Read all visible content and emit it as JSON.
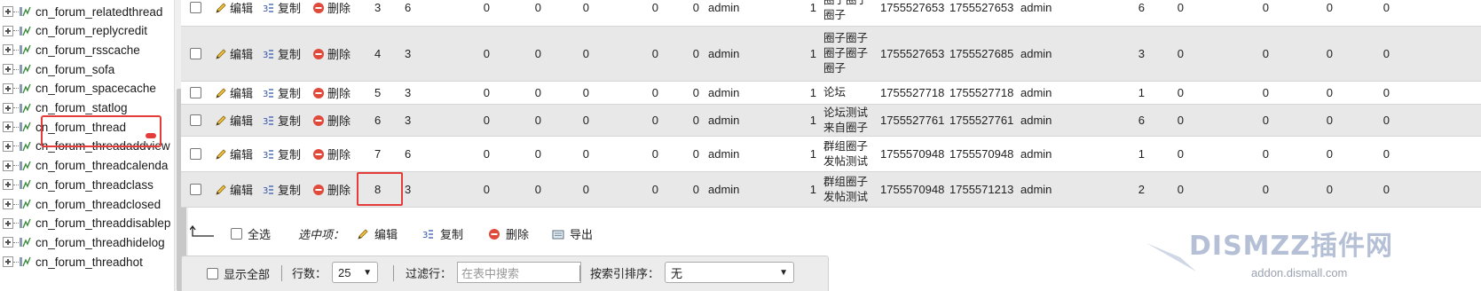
{
  "nav": {
    "items": [
      {
        "label": "cn_forum_relatedthread"
      },
      {
        "label": "cn_forum_replycredit"
      },
      {
        "label": "cn_forum_rsscache"
      },
      {
        "label": "cn_forum_sofa"
      },
      {
        "label": "cn_forum_spacecache"
      },
      {
        "label": "cn_forum_statlog"
      },
      {
        "label": "cn_forum_thread"
      },
      {
        "label": "cn_forum_threadaddview"
      },
      {
        "label": "cn_forum_threadcalenda"
      },
      {
        "label": "cn_forum_threadclass"
      },
      {
        "label": "cn_forum_threadclosed"
      },
      {
        "label": "cn_forum_threaddisablep"
      },
      {
        "label": "cn_forum_threadhidelog"
      },
      {
        "label": "cn_forum_threadhot"
      }
    ],
    "selected": "cn_forum_thread"
  },
  "actions": {
    "edit": "编辑",
    "copy": "复制",
    "delete": "删除"
  },
  "rows": [
    {
      "tid": "3",
      "fid": "6",
      "c1": "0",
      "c2": "0",
      "c3": "0",
      "c4": "0",
      "c5": "0",
      "author": "admin",
      "c6": "1",
      "subject": "圈子圈子圈子",
      "dateline": "1755527653",
      "lastpost": "1755527653",
      "lastposter": "admin",
      "c7": "6",
      "c8": "0",
      "c9": "0",
      "c10": "0",
      "c11": "0"
    },
    {
      "tid": "4",
      "fid": "3",
      "c1": "0",
      "c2": "0",
      "c3": "0",
      "c4": "0",
      "c5": "0",
      "author": "admin",
      "c6": "1",
      "subject": "圈子圈子圈子圈子圈子",
      "dateline": "1755527653",
      "lastpost": "1755527685",
      "lastposter": "admin",
      "c7": "3",
      "c8": "0",
      "c9": "0",
      "c10": "0",
      "c11": "0"
    },
    {
      "tid": "5",
      "fid": "3",
      "c1": "0",
      "c2": "0",
      "c3": "0",
      "c4": "0",
      "c5": "0",
      "author": "admin",
      "c6": "1",
      "subject": "论坛",
      "dateline": "1755527718",
      "lastpost": "1755527718",
      "lastposter": "admin",
      "c7": "1",
      "c8": "0",
      "c9": "0",
      "c10": "0",
      "c11": "0"
    },
    {
      "tid": "6",
      "fid": "3",
      "c1": "0",
      "c2": "0",
      "c3": "0",
      "c4": "0",
      "c5": "0",
      "author": "admin",
      "c6": "1",
      "subject": "论坛测试来自圈子",
      "dateline": "1755527761",
      "lastpost": "1755527761",
      "lastposter": "admin",
      "c7": "6",
      "c8": "0",
      "c9": "0",
      "c10": "0",
      "c11": "0"
    },
    {
      "tid": "7",
      "fid": "6",
      "c1": "0",
      "c2": "0",
      "c3": "0",
      "c4": "0",
      "c5": "0",
      "author": "admin",
      "c6": "1",
      "subject": "群组圈子发帖测试",
      "dateline": "1755570948",
      "lastpost": "1755570948",
      "lastposter": "admin",
      "c7": "1",
      "c8": "0",
      "c9": "0",
      "c10": "0",
      "c11": "0"
    },
    {
      "tid": "8",
      "fid": "3",
      "c1": "0",
      "c2": "0",
      "c3": "0",
      "c4": "0",
      "c5": "0",
      "author": "admin",
      "c6": "1",
      "subject": "群组圈子发帖测试",
      "dateline": "1755570948",
      "lastpost": "1755571213",
      "lastposter": "admin",
      "c7": "2",
      "c8": "0",
      "c9": "0",
      "c10": "0",
      "c11": "0"
    }
  ],
  "bulk": {
    "select_all": "全选",
    "with_selected": "选中项：",
    "edit": "编辑",
    "copy": "复制",
    "delete": "删除",
    "export": "导出"
  },
  "bottom": {
    "show_all": "显示全部",
    "rows_label": "行数：",
    "rows_value": "25",
    "filter_label": "过滤行：",
    "filter_placeholder": "在表中搜索",
    "sort_label": "按索引排序：",
    "sort_value": "无"
  },
  "watermark": {
    "text": "DISMZZ插件网",
    "sub": "addon.dismall.com"
  },
  "colors": {
    "highlight": "#e43b3b",
    "row_alt": "#e8e8e8",
    "delete_icon": "#e04a3a"
  }
}
